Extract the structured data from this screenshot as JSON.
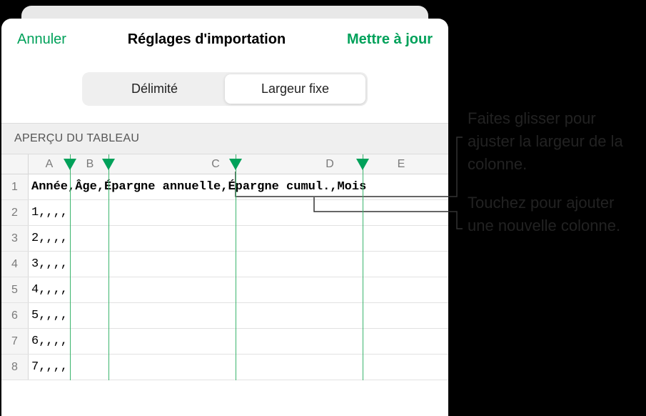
{
  "nav": {
    "cancel": "Annuler",
    "title": "Réglages d'importation",
    "update": "Mettre à jour"
  },
  "segmented": {
    "delimited": "Délimité",
    "fixed_width": "Largeur fixe"
  },
  "section": {
    "preview": "APERÇU DU TABLEAU"
  },
  "columns": {
    "labels": [
      "A",
      "B",
      "C",
      "D",
      "E"
    ],
    "label_positions": [
      38,
      98,
      210,
      400,
      530
    ],
    "label_widths": [
      58,
      52,
      180,
      120,
      60
    ],
    "separators": [
      96,
      150,
      328,
      506
    ],
    "colors": {
      "handle": "#00a15a",
      "line": "#3bb56d"
    }
  },
  "rows": [
    {
      "num": "1",
      "text": "Année,Âge,Épargne annuelle,Épargne cumul.,Mois"
    },
    {
      "num": "2",
      "text": "1,,,,"
    },
    {
      "num": "3",
      "text": "2,,,,"
    },
    {
      "num": "4",
      "text": "3,,,,"
    },
    {
      "num": "5",
      "text": "4,,,,"
    },
    {
      "num": "6",
      "text": "5,,,,"
    },
    {
      "num": "7",
      "text": "6,,,,"
    },
    {
      "num": "8",
      "text": "7,,,,"
    }
  ],
  "annotations": {
    "drag": "Faites glisser pour ajuster la largeur de la colonne.",
    "tap": "Touchez pour ajouter une nouvelle colonne."
  }
}
